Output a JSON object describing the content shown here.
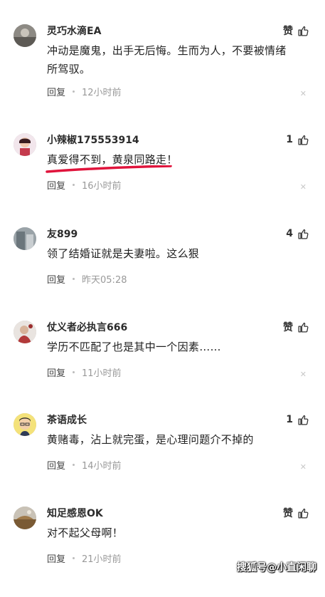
{
  "comments": [
    {
      "username": "灵巧水滴EA",
      "like": "赞",
      "text": "冲动是魔鬼，出手无后悔。生而为人，不要被情绪所驾驭。",
      "reply": "回复",
      "time": "12小时前"
    },
    {
      "username": "小辣椒175553914",
      "like": "1",
      "text": "真爱得不到，黄泉同路走！",
      "reply": "回复",
      "time": "16小时前"
    },
    {
      "username": "友899",
      "like": "4",
      "text": "领了结婚证就是夫妻啦。这么狠",
      "reply": "回复",
      "time": "昨天05:28"
    },
    {
      "username": "仗义者必执言666",
      "like": "赞",
      "text": "学历不匹配了也是其中一个因素……",
      "reply": "回复",
      "time": "11小时前"
    },
    {
      "username": "茶语成长",
      "like": "1",
      "text": "黄赌毒，沾上就完蛋，是心理问题介不掉的",
      "reply": "回复",
      "time": "14小时前"
    },
    {
      "username": "知足感恩OK",
      "like": "赞",
      "text": "对不起父母啊！",
      "reply": "回复",
      "time": "21小时前"
    }
  ],
  "close_glyph": "✕",
  "watermark": "搜狐号@小直闲聊",
  "colors": {
    "underline": "#e0143c",
    "meta_text": "#444444",
    "time_text": "#999999"
  },
  "icons": {
    "like": "thumbs-up-icon",
    "close": "close-icon"
  }
}
